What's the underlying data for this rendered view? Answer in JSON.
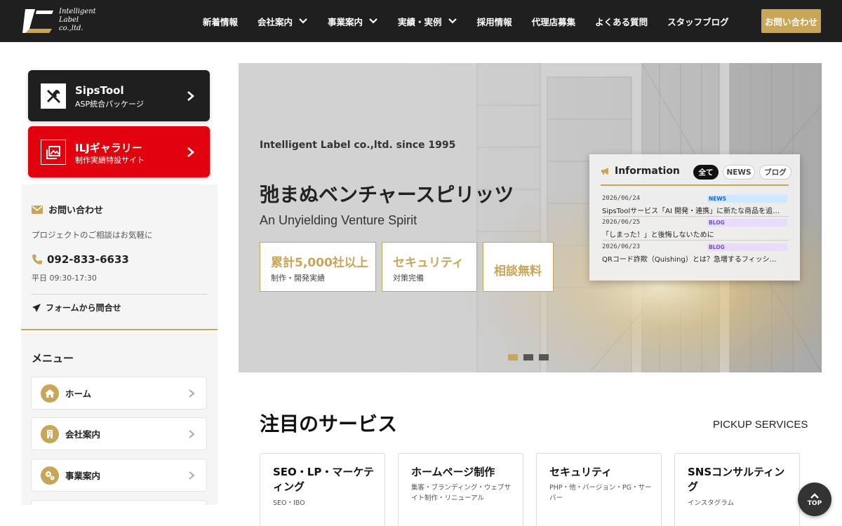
{
  "header": {
    "logo_lines": [
      "Intelligent",
      "Label",
      "co.,ltd."
    ],
    "nav": [
      {
        "label": "新着情報"
      },
      {
        "label": "会社案内"
      },
      {
        "label": "事業案内"
      },
      {
        "label": "実績・実例"
      },
      {
        "label": "採用情報"
      },
      {
        "label": "代理店募集"
      },
      {
        "label": "よくある質問"
      },
      {
        "label": "スタッフブログ"
      }
    ],
    "contact_label": "お問い合わせ"
  },
  "sidebar": {
    "cards": [
      {
        "title": "SipsTool",
        "subtitle": "ASP統合パッケージ",
        "icon": "tools-icon"
      },
      {
        "title": "ILJギャラリー",
        "subtitle": "制作実績特設サイト",
        "icon": "gallery-icon"
      }
    ],
    "contact": {
      "heading": "お問い合わせ",
      "description": "プロジェクトのご相談はお気軽に",
      "phone": "092-833-6633",
      "hours": "平日 09:30-17:30",
      "form_link": "フォームから問合せ"
    },
    "menu": {
      "title": "メニュー",
      "items": [
        {
          "label": "ホーム",
          "icon": "home-icon"
        },
        {
          "label": "会社案内",
          "icon": "building-icon"
        },
        {
          "label": "事業案内",
          "icon": "gears-icon"
        }
      ]
    }
  },
  "hero": {
    "since": "Intelligent Label co.,ltd. since 1995",
    "catch": "弛まぬベンチャースピリッツ",
    "catch_en": "An Unyielding Venture Spirit",
    "badges": [
      {
        "main": "累計5,000社以上",
        "sub": "制作・開発実績"
      },
      {
        "main": "セキュリティ",
        "sub": "対策完備"
      },
      {
        "main": "相談無料",
        "sub": ""
      }
    ],
    "slides": 3,
    "active_slide": 1
  },
  "information": {
    "title": "Information",
    "tabs": [
      "全て",
      "NEWS",
      "ブログ"
    ],
    "active_tab": "全て",
    "items": [
      {
        "date": "2026/06/24",
        "tag": "NEWS",
        "title": "SipsToolサービス「AI 開発・連携」に新たな商品を追…"
      },
      {
        "date": "2026/06/25",
        "tag": "BLOG",
        "title": "「しまった！」と後悔しないために"
      },
      {
        "date": "2026/06/23",
        "tag": "BLOG",
        "title": "QRコード詐欺（Quishing）とは？急増するフィッシ…"
      }
    ]
  },
  "services": {
    "title": "注目のサービス",
    "subtitle": "PICKUP SERVICES",
    "items": [
      {
        "title": "SEO・LP・マーケティング",
        "desc": "SEO・IBO"
      },
      {
        "title": "ホームページ制作",
        "desc": "集客・ブランディング・ウェブサイト制作・リニューアル"
      },
      {
        "title": "セキュリティ",
        "desc": "PHP・他・バージョン・PG・サーバー"
      },
      {
        "title": "SNSコンサルティング",
        "desc": "インスタグラム"
      }
    ]
  },
  "top_button": "TOP",
  "colors": {
    "accent": "#c8a557",
    "header": "#1f1f1f",
    "red": "#e2020d"
  }
}
